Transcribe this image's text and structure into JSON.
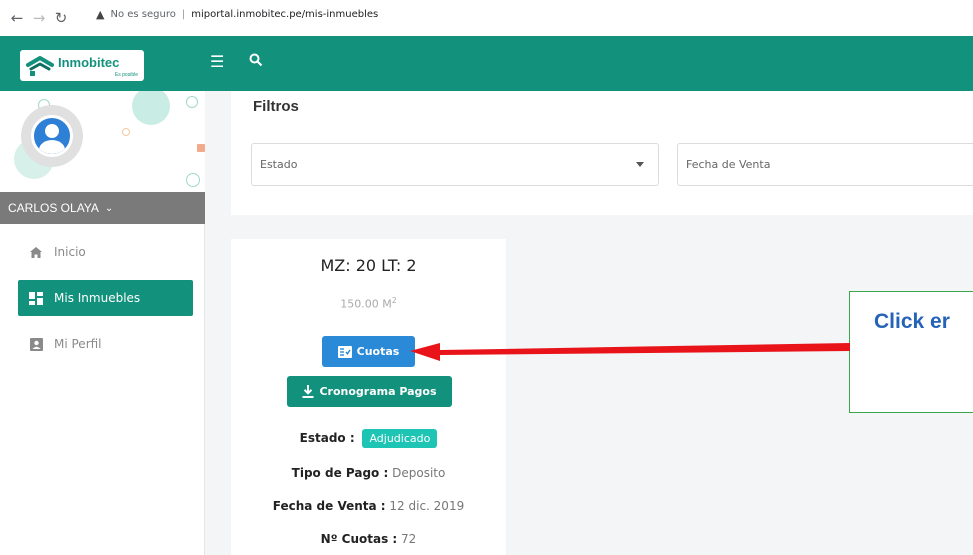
{
  "browser": {
    "security_label": "No es seguro",
    "url": "miportal.inmobitec.pe/mis-inmuebles"
  },
  "header": {
    "brand": "Inmobitec",
    "tagline": "Es posible"
  },
  "sidebar": {
    "user_name": "CARLOS OLAYA",
    "items": [
      {
        "label": "Inicio",
        "icon": "home-icon",
        "active": false
      },
      {
        "label": "Mis Inmuebles",
        "icon": "dashboard-icon",
        "active": true
      },
      {
        "label": "Mi Perfil",
        "icon": "profile-card-icon",
        "active": false
      }
    ]
  },
  "filters": {
    "title": "Filtros",
    "estado_placeholder": "Estado",
    "fecha_placeholder": "Fecha de Venta"
  },
  "property": {
    "title": "MZ: 20 LT: 2",
    "area_value": "150.00 M",
    "area_exp": "2",
    "cuotas_button": "Cuotas",
    "cronograma_button": "Cronograma Pagos",
    "estado_label": "Estado :",
    "estado_value": "Adjudicado",
    "tipo_pago_label": "Tipo de Pago :",
    "tipo_pago_value": "Deposito",
    "fecha_venta_label": "Fecha de Venta :",
    "fecha_venta_value": "12 dic. 2019",
    "cuotas_label": "Nº Cuotas :",
    "cuotas_value": "72"
  },
  "annotation": {
    "text": "Click er"
  },
  "colors": {
    "primary": "#12917c",
    "button_blue": "#2b8ad8",
    "badge": "#1ec4b4",
    "arrow": "#e8141a",
    "callout_text": "#2563b8"
  }
}
